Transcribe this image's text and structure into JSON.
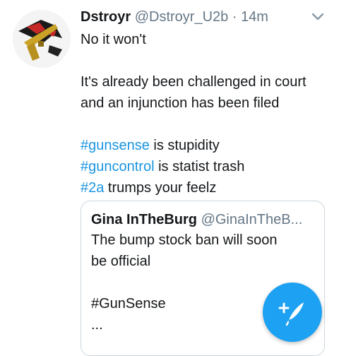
{
  "tweet": {
    "display_name": "Dstroyr",
    "handle": "@Dstroyr_U2b",
    "separator": "·",
    "timestamp": "14m",
    "line1": "No it won't",
    "line2": "It's already been challenged in court",
    "line3": "and an injunction has been filed",
    "tag1": "#gunsense",
    "tag1_rest": " is stupidity",
    "tag2": "#guncontrol",
    "tag2_rest": " is statist trash",
    "tag3": "#2a",
    "tag3_rest": " trumps your feelz"
  },
  "quoted_tweet": {
    "display_name": "Gina InTheBurg",
    "handle": "@GinaInTheB...",
    "line1": "The bump stock ban will soon",
    "line2": "be official",
    "tag": "#GunSense",
    "ellipsis": "..."
  },
  "icons": {
    "avatar": "avatar-image",
    "more": "chevron-down-icon",
    "compose": "compose-tweet-icon"
  },
  "colors": {
    "link": "#1b95e0",
    "secondary_text": "#657786",
    "fab": "#1da1f2"
  }
}
